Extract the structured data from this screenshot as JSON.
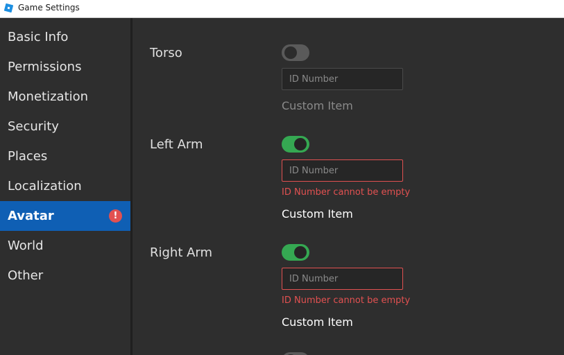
{
  "window": {
    "title": "Game Settings",
    "logo_icon": "roblox-studio-icon"
  },
  "sidebar": {
    "items": [
      {
        "label": "Basic Info"
      },
      {
        "label": "Permissions"
      },
      {
        "label": "Monetization"
      },
      {
        "label": "Security"
      },
      {
        "label": "Places"
      },
      {
        "label": "Localization"
      },
      {
        "label": "Avatar",
        "active": true,
        "badge": "!"
      },
      {
        "label": "World"
      },
      {
        "label": "Other"
      }
    ]
  },
  "colors": {
    "active_nav": "#0f5fb4",
    "toggle_on": "#35a852",
    "toggle_off": "#5a5a5a",
    "error": "#e25151"
  },
  "avatar": {
    "parts": [
      {
        "label": "Torso",
        "toggle_on": false,
        "id_placeholder": "ID Number",
        "id_value": "",
        "error": "",
        "custom_label": "Custom Item"
      },
      {
        "label": "Left Arm",
        "toggle_on": true,
        "id_placeholder": "ID Number",
        "id_value": "",
        "error": "ID Number cannot be empty",
        "custom_label": "Custom Item"
      },
      {
        "label": "Right Arm",
        "toggle_on": true,
        "id_placeholder": "ID Number",
        "id_value": "",
        "error": "ID Number cannot be empty",
        "custom_label": "Custom Item"
      }
    ]
  }
}
